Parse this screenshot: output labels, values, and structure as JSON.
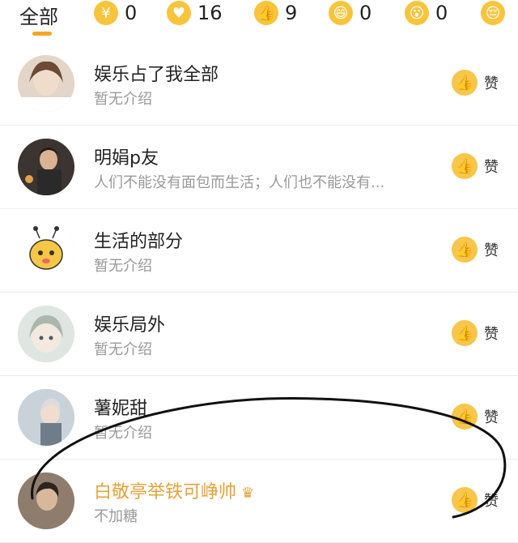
{
  "tabs": {
    "all_label": "全部",
    "reactions": [
      {
        "icon": "coin-icon",
        "glyph": "¥",
        "count": "0"
      },
      {
        "icon": "heart-icon",
        "glyph": "♥",
        "count": "16"
      },
      {
        "icon": "thumbs-up-icon",
        "glyph": "👍",
        "count": "9"
      },
      {
        "icon": "laugh-icon",
        "glyph": "😄",
        "count": "0"
      },
      {
        "icon": "surprised-icon",
        "glyph": "😮",
        "count": "0"
      },
      {
        "icon": "sad-icon",
        "glyph": "😔",
        "count": ""
      }
    ]
  },
  "list": {
    "like_label": "赞",
    "rows": [
      {
        "name": "娱乐占了我全部",
        "desc": "暂无介绍"
      },
      {
        "name": "明娟p友",
        "desc": "人们不能没有面包而生活；人们也不能没有..."
      },
      {
        "name": "生活的部分",
        "desc": "暂无介绍"
      },
      {
        "name": "娱乐局外",
        "desc": "暂无介绍"
      },
      {
        "name": "薯妮甜",
        "desc": "暂无介绍"
      },
      {
        "name": "白敬亭举铁可峥帅",
        "desc": "不加糖"
      }
    ]
  },
  "colors": {
    "accent": "#f5a623",
    "highlight_name": "#e5a23a"
  }
}
